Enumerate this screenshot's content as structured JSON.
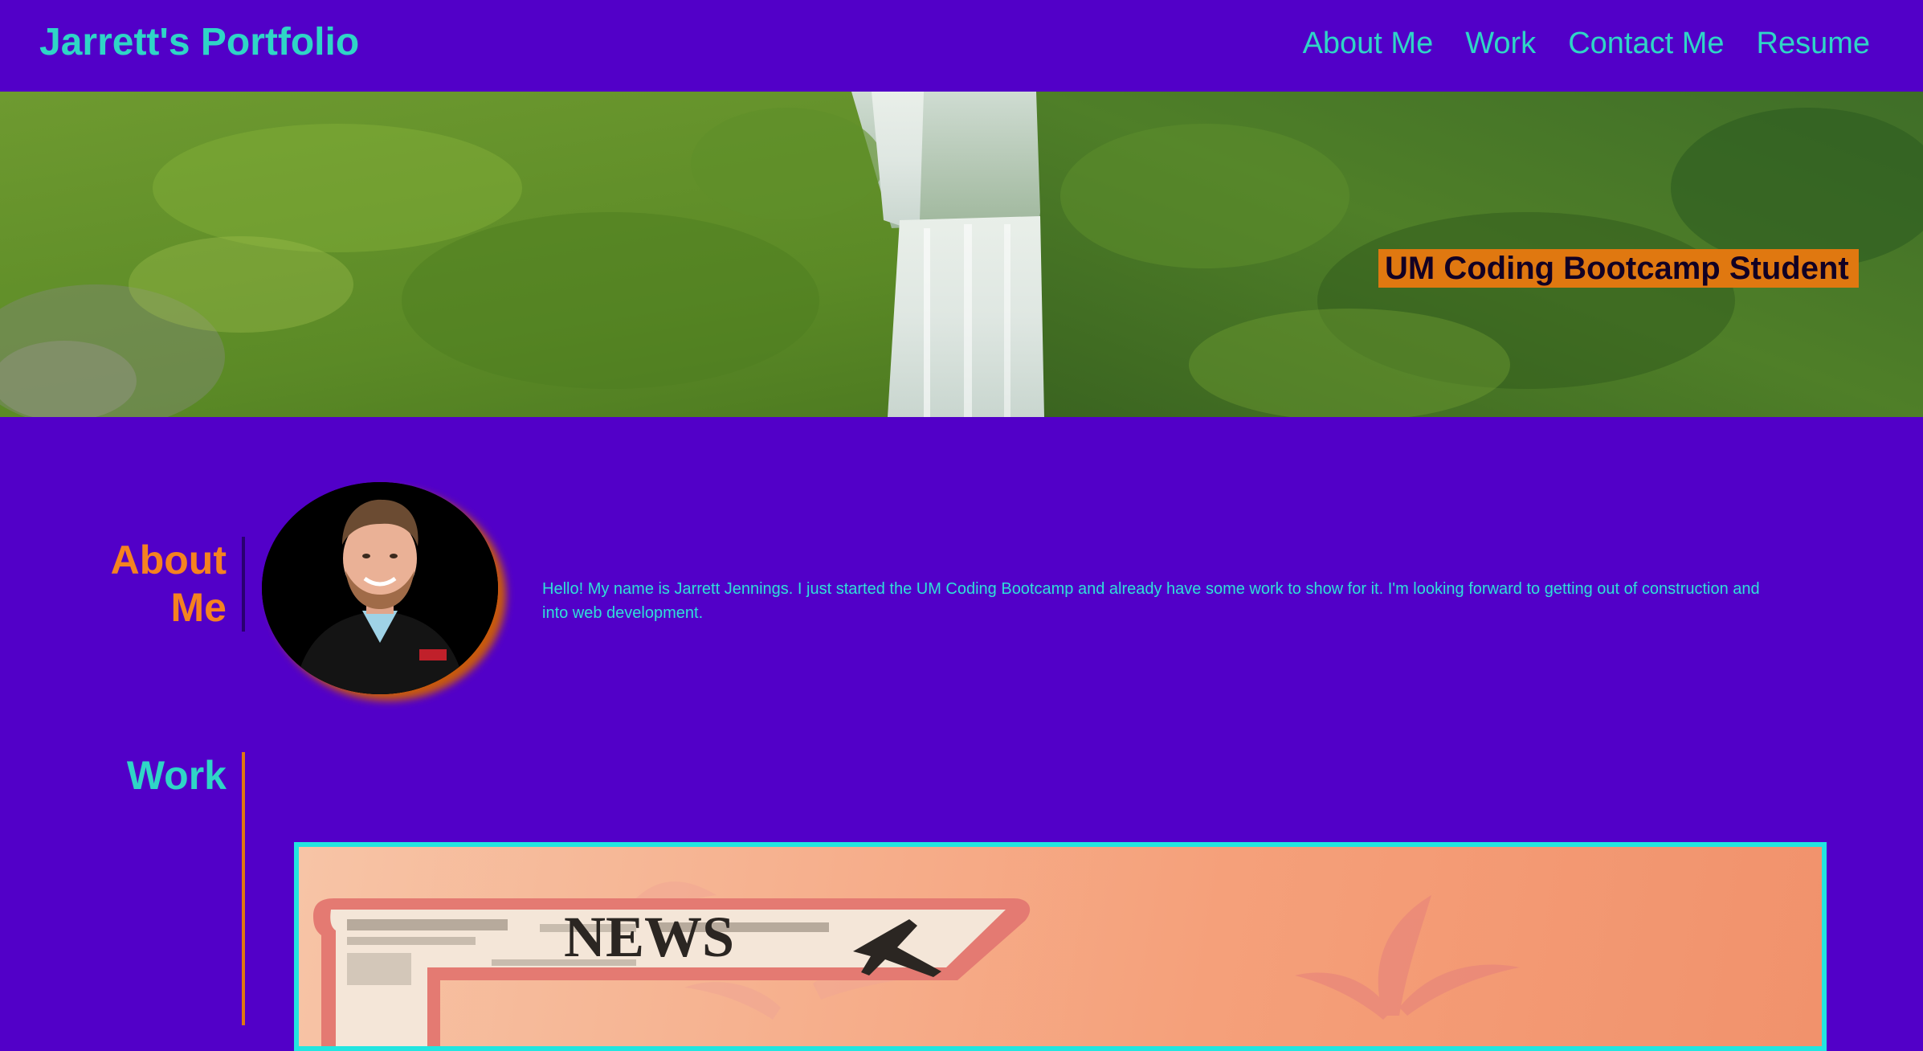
{
  "header": {
    "brand": "Jarrett's Portfolio",
    "nav": [
      "About Me",
      "Work",
      "Contact Me",
      "Resume"
    ]
  },
  "hero": {
    "tagline": "UM Coding Bootcamp Student",
    "image": "waterfall-landscape"
  },
  "about": {
    "heading_line1": "About",
    "heading_line2": "Me",
    "avatar": "profile-photo",
    "text": "Hello! My name is Jarrett Jennings. I just started the UM Coding Bootcamp and already have some work to show for it. I'm looking forward to getting out of construction and into web development."
  },
  "work": {
    "heading": "Work",
    "project_image_text": "NEWS"
  },
  "colors": {
    "background": "#5200c8",
    "accent_teal": "#2fd5c6",
    "accent_orange": "#f58220",
    "tagline_bg": "#e07810",
    "card_border": "#22e5e0"
  }
}
